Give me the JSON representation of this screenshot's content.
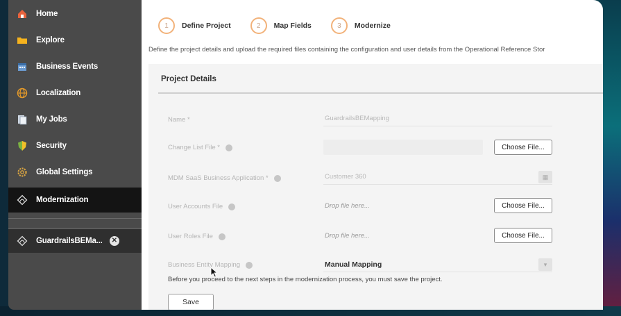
{
  "sidebar": {
    "items": [
      {
        "label": "Home",
        "icon": "home-icon"
      },
      {
        "label": "Explore",
        "icon": "folder-icon"
      },
      {
        "label": "Business Events",
        "icon": "calendar-icon"
      },
      {
        "label": "Localization",
        "icon": "globe-icon"
      },
      {
        "label": "My Jobs",
        "icon": "jobs-icon"
      },
      {
        "label": "Security",
        "icon": "shield-icon"
      },
      {
        "label": "Global Settings",
        "icon": "gear-icon"
      },
      {
        "label": "Modernization",
        "icon": "modernization-icon"
      }
    ],
    "active_item": "Modernization",
    "open_job": {
      "label": "GuardrailsBEMa...",
      "close_icon": "close-icon"
    }
  },
  "steps": [
    {
      "number": "1",
      "label": "Define Project"
    },
    {
      "number": "2",
      "label": "Map Fields"
    },
    {
      "number": "3",
      "label": "Modernize"
    }
  ],
  "description": "Define the project details and upload the required files containing the configuration and user details from the Operational Reference Stor",
  "section_title": "Project Details",
  "form": {
    "name_label": "Name *",
    "name_value": "GuardrailsBEMapping",
    "change_list_label": "Change List File *",
    "change_list_button": "Choose File...",
    "app_label": "MDM SaaS Business Application *",
    "app_value": "Customer 360",
    "user_accounts_label": "User Accounts File",
    "user_accounts_placeholder": "Drop file here...",
    "user_accounts_button": "Choose File...",
    "user_roles_label": "User Roles File",
    "user_roles_placeholder": "Drop file here...",
    "user_roles_button": "Choose File...",
    "mapping_label": "Business Entity Mapping",
    "mapping_value": "Manual Mapping"
  },
  "notice": "Before you proceed to the next steps in the modernization process, you must save the project.",
  "save_button": "Save",
  "colors": {
    "sidebar_bg": "#4a4a4a",
    "sidebar_active": "#141414",
    "step_active_ring": "#f2b27a"
  }
}
